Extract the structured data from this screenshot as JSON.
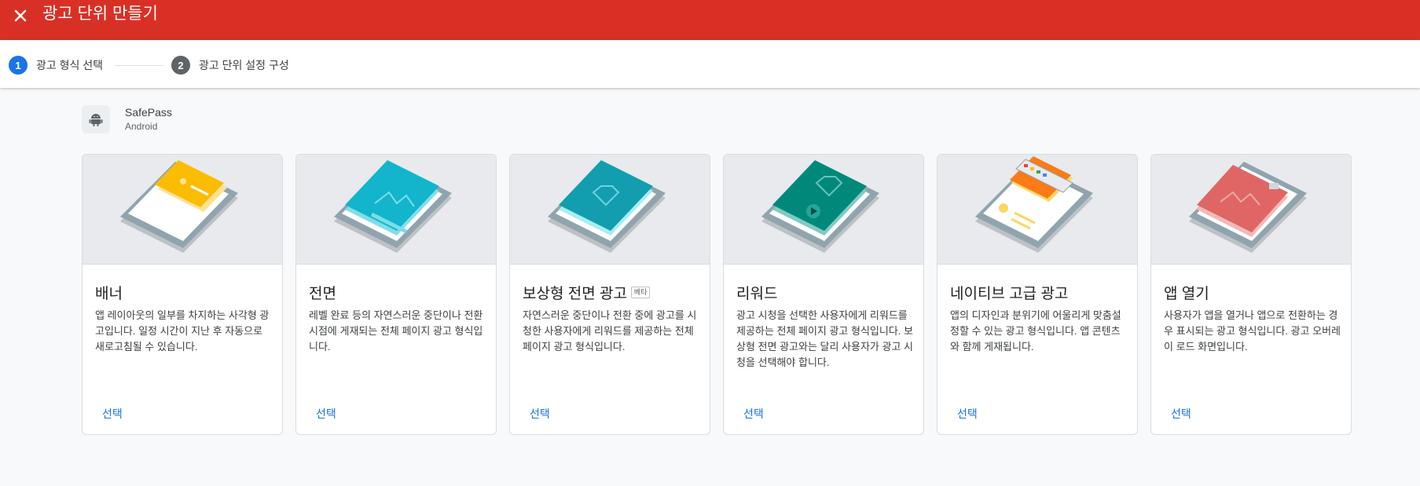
{
  "header": {
    "title": "광고 단위 만들기"
  },
  "stepper": {
    "steps": [
      {
        "number": "1",
        "label": "광고 형식 선택"
      },
      {
        "number": "2",
        "label": "광고 단위 설정 구성"
      }
    ]
  },
  "app": {
    "name": "SafePass",
    "platform": "Android"
  },
  "cards": [
    {
      "title": "배너",
      "description": "앱 레이아웃의 일부를 차지하는 사각형 광고입니다. 일정 시간이 지난 후 자동으로 새로고침될 수 있습니다.",
      "button": "선택",
      "illustration": "banner-illustration",
      "accent": "#fbbc04"
    },
    {
      "title": "전면",
      "description": "레벨 완료 등의 자연스러운 중단이나 전환 시점에 게재되는 전체 페이지 광고 형식입니다.",
      "button": "선택",
      "illustration": "interstitial-illustration",
      "accent": "#12b5cb"
    },
    {
      "title": "보상형 전면 광고",
      "badge": "베타",
      "description": "자연스러운 중단이나 전환 중에 광고를 시청한 사용자에게 리워드를 제공하는 전체 페이지 광고 형식입니다.",
      "button": "선택",
      "illustration": "rewarded-interstitial-illustration",
      "accent": "#129eaf"
    },
    {
      "title": "리워드",
      "description": "광고 시청을 선택한 사용자에게 리워드를 제공하는 전체 페이지 광고 형식입니다. 보상형 전면 광고와는 달리 사용자가 광고 시청을 선택해야 합니다.",
      "button": "선택",
      "illustration": "rewarded-illustration",
      "accent": "#00897b"
    },
    {
      "title": "네이티브 고급 광고",
      "description": "앱의 디자인과 분위기에 어울리게 맞춤설정할 수 있는 광고 형식입니다. 앱 콘텐츠와 함께 게재됩니다.",
      "button": "선택",
      "illustration": "native-advanced-illustration",
      "accent": "#fa7b17"
    },
    {
      "title": "앱 열기",
      "description": "사용자가 앱을 열거나 앱으로 전환하는 경우 표시되는 광고 형식입니다. 광고 오버레이 로드 화면입니다.",
      "button": "선택",
      "illustration": "app-open-illustration",
      "accent": "#e06666"
    }
  ],
  "colors": {
    "header_bg": "#d93025",
    "primary": "#1a73e8",
    "step_inactive": "#5f6368"
  }
}
